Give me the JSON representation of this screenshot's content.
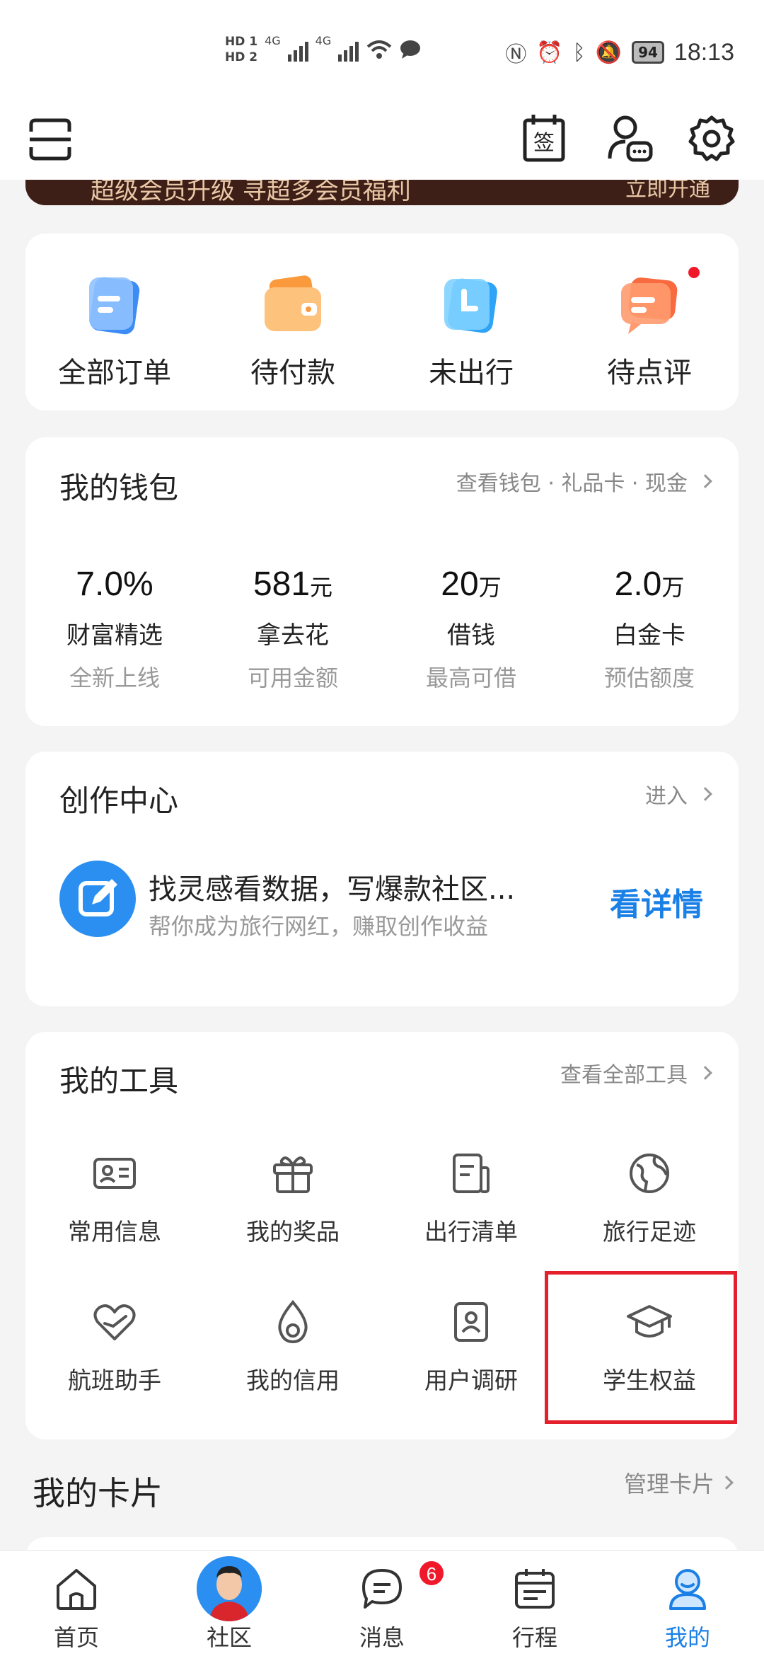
{
  "status_bar": {
    "hd1": "HD 1",
    "hd2": "HD 2",
    "net1": "4G",
    "net2": "4G",
    "battery": "94",
    "time": "18:13"
  },
  "banner": {
    "text": "超级会员升级 寻超多会员福利",
    "link": "立即开通"
  },
  "orders": [
    {
      "label": "全部订单",
      "icon": "all-orders-icon",
      "color": "#3d8cf5"
    },
    {
      "label": "待付款",
      "icon": "wallet-payment-icon",
      "color": "#fb9a3c"
    },
    {
      "label": "未出行",
      "icon": "clock-trip-icon",
      "color": "#2fa4f7"
    },
    {
      "label": "待点评",
      "icon": "review-chat-icon",
      "color": "#f86a3f"
    }
  ],
  "wallet": {
    "title": "我的钱包",
    "link": "查看钱包 · 礼品卡 · 现金",
    "items": [
      {
        "value": "7.0%",
        "unit": "",
        "name": "财富精选",
        "sub": "全新上线"
      },
      {
        "value": "581",
        "unit": "元",
        "name": "拿去花",
        "sub": "可用金额"
      },
      {
        "value": "20",
        "unit": "万",
        "name": "借钱",
        "sub": "最高可借"
      },
      {
        "value": "2.0",
        "unit": "万",
        "name": "白金卡",
        "sub": "预估额度"
      }
    ]
  },
  "creator": {
    "title": "创作中心",
    "link": "进入",
    "headline": "找灵感看数据，写爆款社区...",
    "sub": "帮你成为旅行网红，赚取创作收益",
    "detail": "看详情"
  },
  "tools": {
    "title": "我的工具",
    "link": "查看全部工具",
    "items": [
      {
        "label": "常用信息",
        "icon": "id-card-icon"
      },
      {
        "label": "我的奖品",
        "icon": "gift-icon"
      },
      {
        "label": "出行清单",
        "icon": "checklist-icon"
      },
      {
        "label": "旅行足迹",
        "icon": "globe-icon"
      },
      {
        "label": "航班助手",
        "icon": "flight-heart-icon"
      },
      {
        "label": "我的信用",
        "icon": "credit-drop-icon"
      },
      {
        "label": "用户调研",
        "icon": "survey-icon"
      },
      {
        "label": "学生权益",
        "icon": "graduation-cap-icon"
      }
    ]
  },
  "cards": {
    "title": "我的卡片",
    "link": "管理卡片"
  },
  "tabbar": {
    "tabs": [
      {
        "label": "首页",
        "icon": "home-icon"
      },
      {
        "label": "社区",
        "icon": "avatar"
      },
      {
        "label": "消息",
        "icon": "message-icon",
        "badge": "6"
      },
      {
        "label": "行程",
        "icon": "calendar-icon"
      },
      {
        "label": "我的",
        "icon": "profile-icon",
        "active": true
      }
    ]
  },
  "header": {
    "sign_label": "签"
  },
  "colors": {
    "accent": "#1a80e6",
    "highlight": "#e3202b",
    "badge": "#f0192b"
  }
}
